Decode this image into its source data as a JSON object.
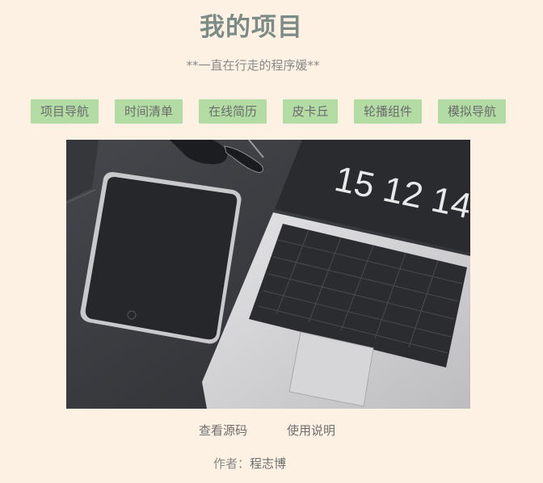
{
  "header": {
    "title": "我的项目",
    "subtitle": "**一直在行走的程序媛**"
  },
  "nav": {
    "items": [
      {
        "label": "项目导航"
      },
      {
        "label": "时间清单"
      },
      {
        "label": "在线简历"
      },
      {
        "label": "皮卡丘"
      },
      {
        "label": "轮播组件"
      },
      {
        "label": "模拟导航"
      }
    ]
  },
  "hero": {
    "clock_text": "15 12 14"
  },
  "links": {
    "source": "查看源码",
    "usage": "使用说明"
  },
  "footer": {
    "author_prefix": "作者：",
    "author_name": "程志博"
  },
  "colors": {
    "background": "#fdf1e3",
    "nav_button": "#b3dca5",
    "title": "#7b8c87"
  }
}
